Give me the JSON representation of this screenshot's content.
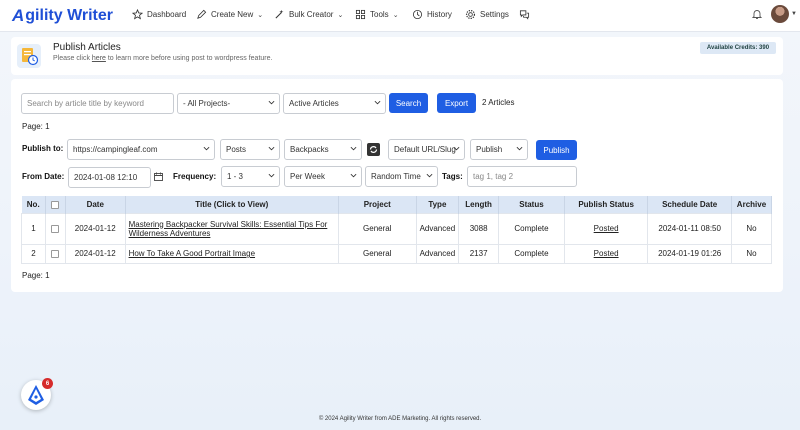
{
  "app": {
    "logo_text": "gility Writer",
    "logo_letter": "A"
  },
  "nav": {
    "items": [
      {
        "label": "Dashboard",
        "icon": "star-icon"
      },
      {
        "label": "Create New",
        "icon": "pen-icon"
      },
      {
        "label": "Bulk Creator",
        "icon": "wand-icon"
      },
      {
        "label": "Tools",
        "icon": "grid-icon"
      },
      {
        "label": "History",
        "icon": "history-icon"
      },
      {
        "label": "Settings",
        "icon": "gear-icon"
      },
      {
        "label": "",
        "icon": "chat-icon"
      }
    ]
  },
  "header": {
    "title": "Publish Articles",
    "subtitle_pre": "Please click ",
    "subtitle_link": "here",
    "subtitle_post": " to learn more before using post to wordpress feature.",
    "credits": "Available Credits: 390"
  },
  "filters": {
    "search_placeholder": "Search by article title by keyword",
    "projects": "- All Projects-",
    "status": "Active Articles",
    "search_button": "Search",
    "export_button": "Export",
    "count": "2 Articles"
  },
  "page_label": "Page: 1",
  "publish": {
    "label": "Publish to:",
    "site": "https://campingleaf.com",
    "post_type": "Posts",
    "category": "Backpacks",
    "url_slug": "Default URL/Slug",
    "action": "Publish",
    "publish_button": "Publish"
  },
  "schedule": {
    "from_label": "From Date:",
    "from_value": "2024-01-08 12:10",
    "freq_label": "Frequency:",
    "freq_value": "1 - 3",
    "period": "Per Week",
    "time": "Random Time",
    "tags_label": "Tags:",
    "tags_placeholder": "tag 1, tag 2"
  },
  "table": {
    "headers": [
      "No.",
      "",
      "Date",
      "Title (Click to View)",
      "Project",
      "Type",
      "Length",
      "Status",
      "Publish Status",
      "Schedule Date",
      "Archive"
    ],
    "rows": [
      {
        "no": "1",
        "date": "2024-01-12",
        "title": "Mastering Backpacker Survival Skills: Essential Tips For Wilderness Adventures",
        "project": "General",
        "type": "Advanced",
        "length": "3088",
        "status": "Complete",
        "publish_status": "Posted",
        "schedule_date": "2024-01-11 08:50",
        "archive": "No"
      },
      {
        "no": "2",
        "date": "2024-01-12",
        "title": "How To Take A Good Portrait Image",
        "project": "General",
        "type": "Advanced",
        "length": "2137",
        "status": "Complete",
        "publish_status": "Posted",
        "schedule_date": "2024-01-19 01:26",
        "archive": "No"
      }
    ]
  },
  "page_label_bottom": "Page: 1",
  "footer": "© 2024 Agility Writer from ADE Marketing. All rights reserved.",
  "help_badge_count": "6",
  "colors": {
    "brand": "#1f4fd6",
    "button": "#1f5ee3",
    "table_header": "#dbe6f5"
  }
}
